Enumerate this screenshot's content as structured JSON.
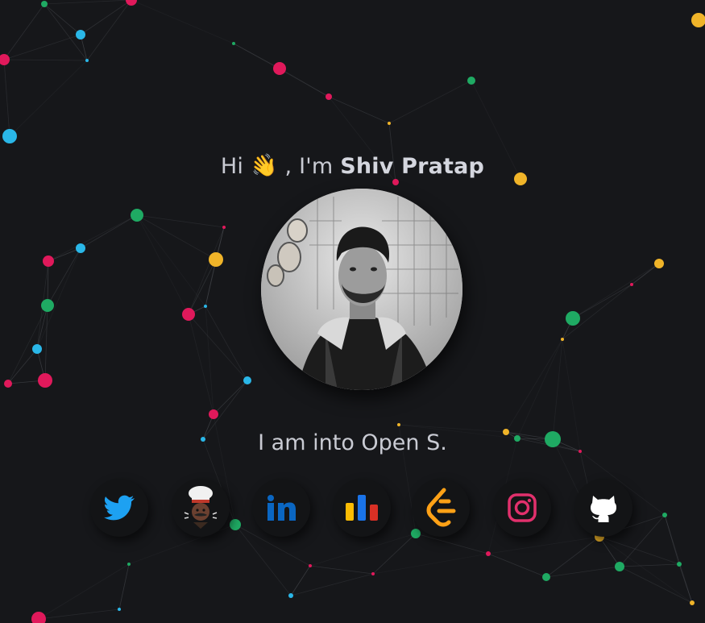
{
  "hero": {
    "greeting_prefix": "Hi",
    "wave_emoji": "👋",
    "greeting_middle": ", I'm",
    "name": "Shiv Pratap",
    "typed_text": "I am into Open S."
  },
  "avatar_icon": "profile-photo-grayscale",
  "socials": [
    {
      "name": "twitter",
      "icon": "twitter-bird-icon",
      "color": "#1da1f2"
    },
    {
      "name": "codechef",
      "icon": "chef-icon",
      "color": "#8b5a3c"
    },
    {
      "name": "linkedin",
      "icon": "linkedin-icon",
      "color": "#0a66c2"
    },
    {
      "name": "stats",
      "icon": "bar-chart-icon",
      "color": "#fbbc04"
    },
    {
      "name": "leetcode",
      "icon": "leetcode-icon",
      "color": "#ffa116"
    },
    {
      "name": "instagram",
      "icon": "instagram-icon",
      "color": "#e1306c"
    },
    {
      "name": "github",
      "icon": "github-icon",
      "color": "#ffffff"
    }
  ],
  "colors": {
    "background": "#16171a",
    "node_pink": "#e0195b",
    "node_blue": "#2ab7e8",
    "node_green": "#1faa63",
    "node_yellow": "#f0b429"
  }
}
